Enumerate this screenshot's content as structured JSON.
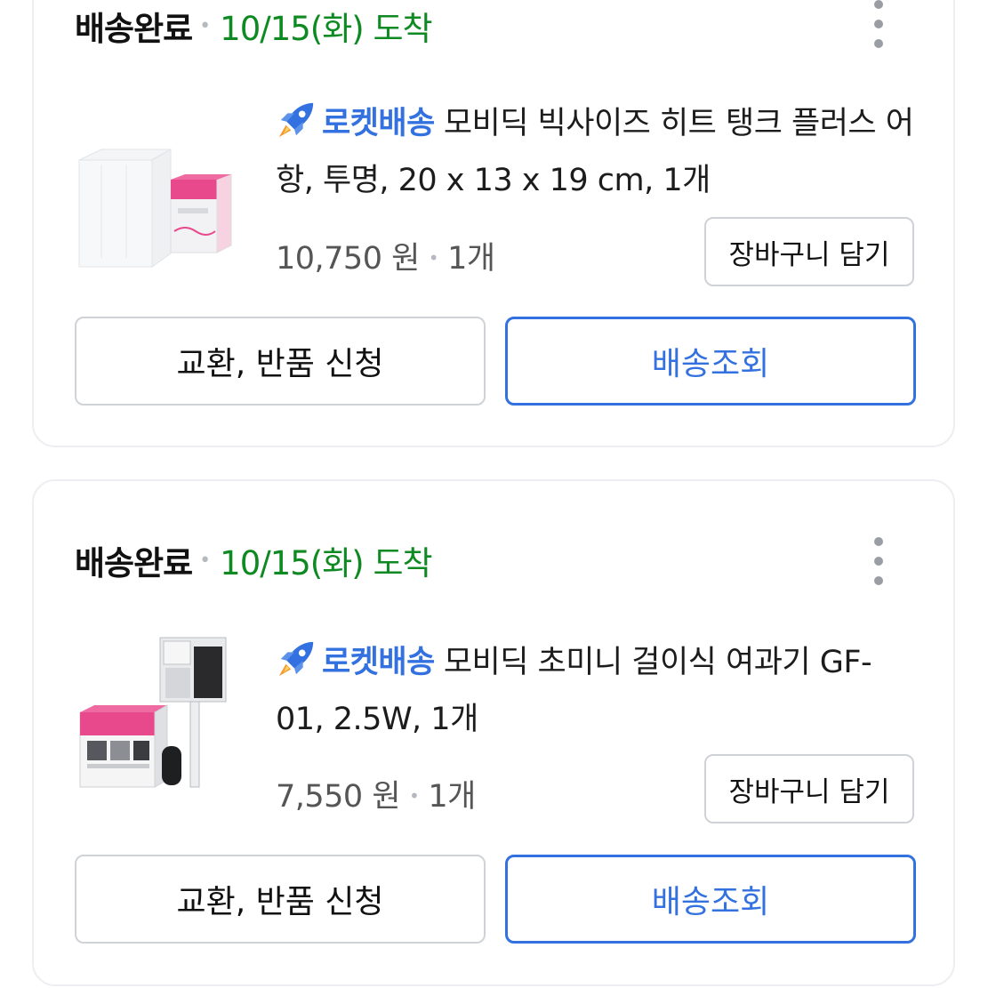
{
  "orders": [
    {
      "status": "배송완료",
      "arrival": "10/15(화) 도착",
      "badge": "로켓배송",
      "title": "모비딕 빅사이즈 히트 탱크 플러스 어항, 투명, 20 x 13 x 19 cm, 1개",
      "price": "10,750 원",
      "quantity": "1개",
      "cart_label": "장바구니 담기",
      "return_label": "교환, 반품 신청",
      "track_label": "배송조회"
    },
    {
      "status": "배송완료",
      "arrival": "10/15(화) 도착",
      "badge": "로켓배송",
      "title": "모비딕 초미니 걸이식 여과기 GF-01, 2.5W, 1개",
      "price": "7,550 원",
      "quantity": "1개",
      "cart_label": "장바구니 담기",
      "return_label": "교환, 반품 신청",
      "track_label": "배송조회"
    }
  ],
  "colors": {
    "arrival_green": "#0f8a22",
    "rocket_blue": "#3271df",
    "rocket_orange": "#f39a2b",
    "card_border": "#eceef1",
    "button_border": "#cfd2d6"
  },
  "icons": {
    "more": "more-vertical-icon",
    "badge": "rocket-icon"
  }
}
